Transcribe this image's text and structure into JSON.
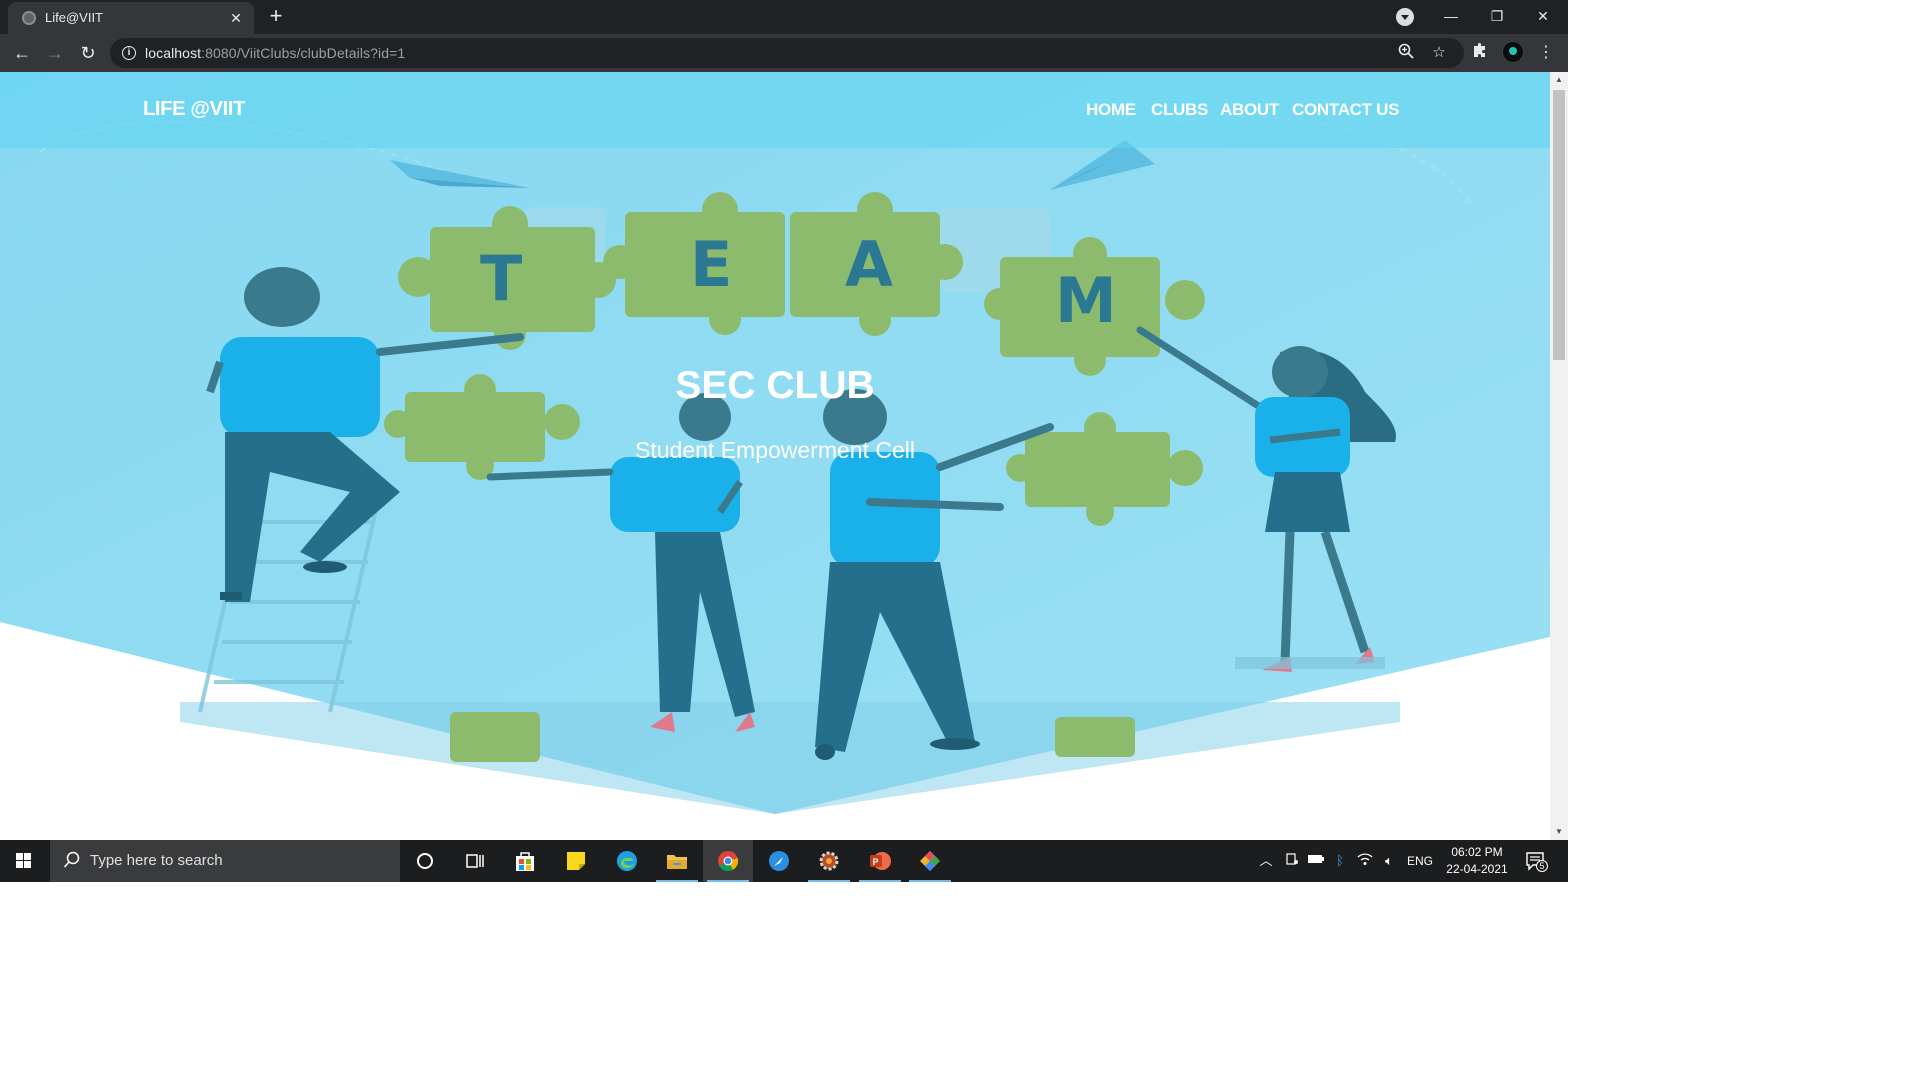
{
  "browser": {
    "tab_title": "Life@VIIT",
    "url_host": "localhost",
    "url_path": ":8080/ViitClubs/clubDetails?id=1"
  },
  "site": {
    "brand": "LIFE @VIIT",
    "nav": [
      "HOME",
      "CLUBS",
      "ABOUT",
      "CONTACT US"
    ],
    "hero_title": "SEC CLUB",
    "hero_subtitle": "Student Empowerment Cell",
    "illustration_letters": [
      "T",
      "E",
      "A",
      "M"
    ]
  },
  "taskbar": {
    "search_placeholder": "Type here to search",
    "language": "ENG",
    "time": "06:02 PM",
    "date": "22-04-2021",
    "notification_count": "5"
  },
  "colors": {
    "hero_bg": "#8fdcf3",
    "navbar_bg": "#5cd6f0",
    "puzzle_green": "#8dbb6e",
    "letter_blue": "#2a7891",
    "shirt_blue": "#1ab1ea",
    "pants_blue": "#24708c"
  }
}
